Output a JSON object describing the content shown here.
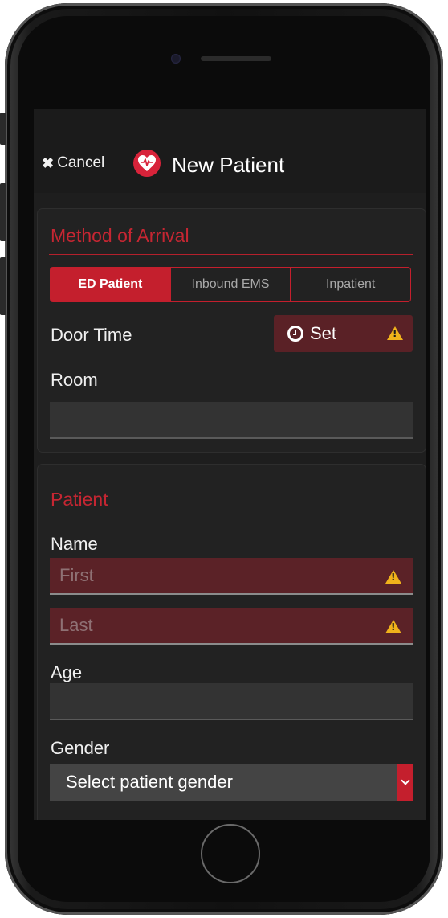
{
  "header": {
    "cancel_label": "Cancel",
    "title": "New Patient"
  },
  "arrival": {
    "section_title": "Method of Arrival",
    "options": [
      "ED Patient",
      "Inbound EMS",
      "Inpatient"
    ],
    "selected": "ED Patient",
    "door_time_label": "Door Time",
    "set_label": "Set",
    "room_label": "Room",
    "room_value": ""
  },
  "patient": {
    "section_title": "Patient",
    "name_label": "Name",
    "first_placeholder": "First",
    "last_placeholder": "Last",
    "age_label": "Age",
    "age_value": "",
    "gender_label": "Gender",
    "gender_selected": "Select patient gender"
  },
  "icons": {
    "cancel": "close-icon",
    "brand": "heart-pulse-icon",
    "clock": "clock-icon",
    "warning": "warning-icon",
    "chevron": "chevron-down-icon"
  },
  "colors": {
    "accent": "#c41f2d",
    "error_field": "#5b2227",
    "warning": "#f0b21b",
    "background": "#1e1e1e"
  }
}
